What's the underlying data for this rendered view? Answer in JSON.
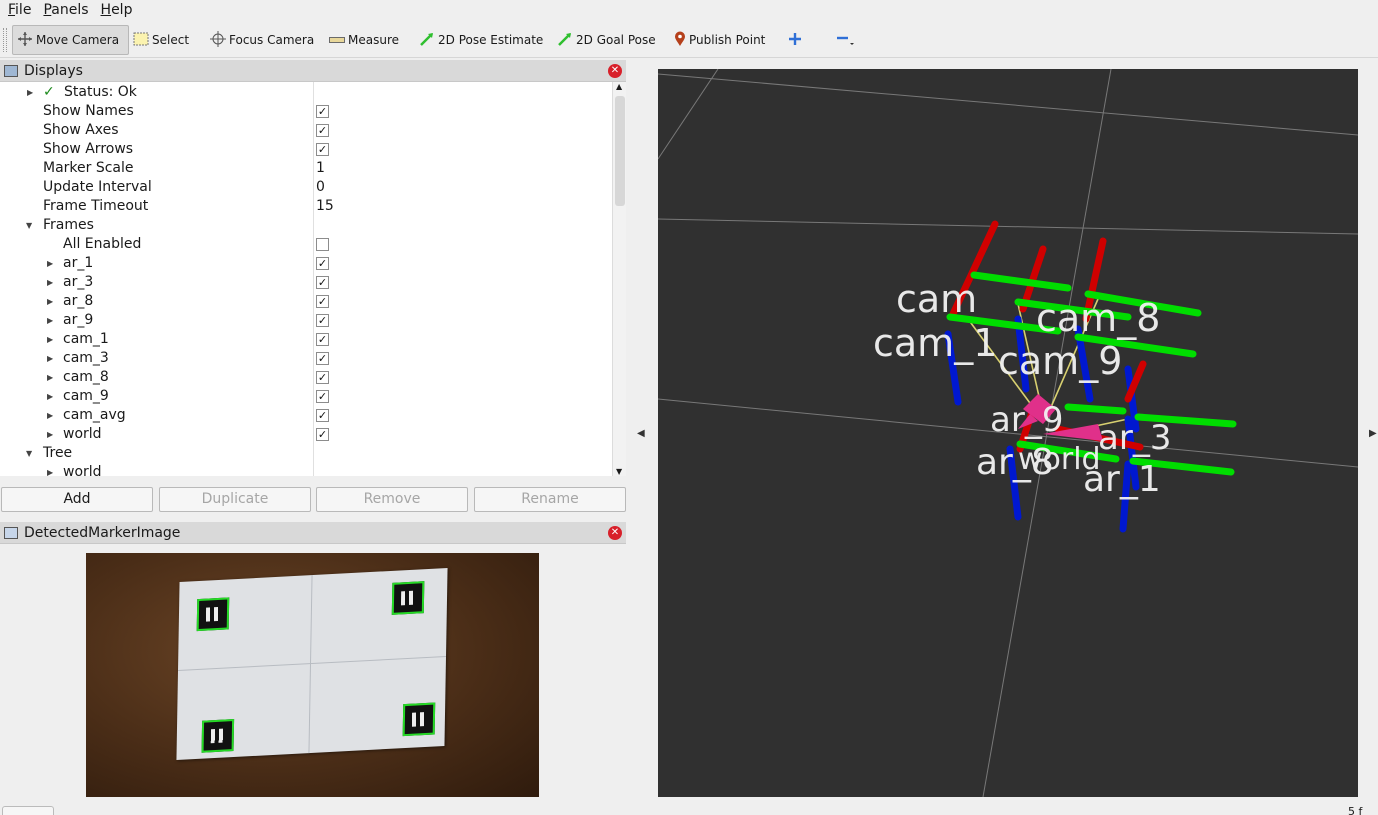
{
  "menubar": {
    "items": [
      {
        "first": "F",
        "rest": "ile"
      },
      {
        "first": "P",
        "rest": "anels"
      },
      {
        "first": "H",
        "rest": "elp"
      }
    ]
  },
  "toolbar": {
    "move_camera": "Move Camera",
    "select": "Select",
    "focus_camera": "Focus Camera",
    "measure": "Measure",
    "pose_estimate": "2D Pose Estimate",
    "goal_pose": "2D Goal Pose",
    "publish_point": "Publish Point"
  },
  "displays": {
    "title": "Displays",
    "status_label": "Status: Ok",
    "rows": [
      {
        "label": "Show Names",
        "checked": true
      },
      {
        "label": "Show Axes",
        "checked": true
      },
      {
        "label": "Show Arrows",
        "checked": true
      },
      {
        "label": "Marker Scale",
        "value": "1"
      },
      {
        "label": "Update Interval",
        "value": "0"
      },
      {
        "label": "Frame Timeout",
        "value": "15"
      }
    ],
    "frames_label": "Frames",
    "all_enabled": "All Enabled",
    "frames": [
      "ar_1",
      "ar_3",
      "ar_8",
      "ar_9",
      "cam_1",
      "cam_3",
      "cam_8",
      "cam_9",
      "cam_avg",
      "world"
    ],
    "tree_label": "Tree",
    "tree_child": "world"
  },
  "buttons": {
    "add": "Add",
    "duplicate": "Duplicate",
    "remove": "Remove",
    "rename": "Rename"
  },
  "image_panel": {
    "title": "DetectedMarkerImage"
  },
  "viewport": {
    "labels": [
      "cam",
      "cam_8",
      "cam_1",
      "cam_9",
      "ar_3",
      "ar_8",
      "ar_1",
      "world",
      "ar_9"
    ],
    "colors": {
      "x_axis": "#d00000",
      "y_axis": "#00dd00",
      "z_axis": "#0018d0",
      "arrow": "#e0308a",
      "link": "#d8d070"
    }
  },
  "status": {
    "corner": "5 f"
  }
}
